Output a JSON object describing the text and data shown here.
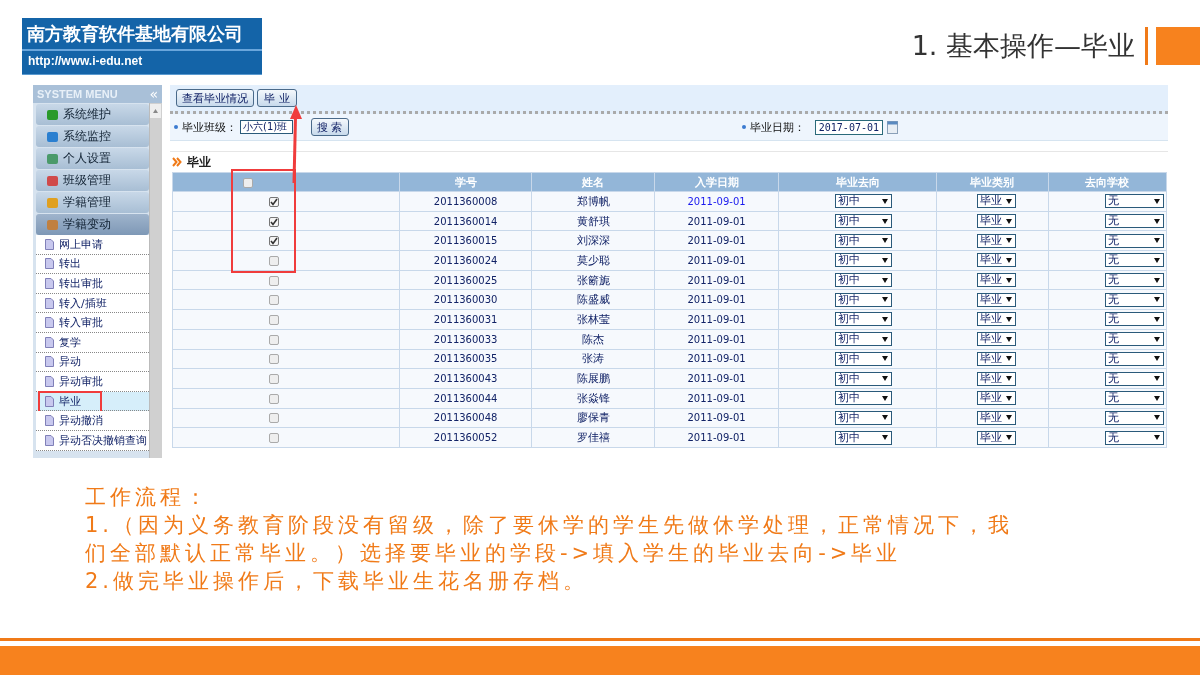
{
  "logo": {
    "name": "南方教育软件基地有限公司",
    "url": "http://www.i-edu.net"
  },
  "slide_title": "1. 基本操作—毕业",
  "sidebar": {
    "title": "SYSTEM MENU",
    "collapse": "«",
    "groups": [
      {
        "label": "系统维护",
        "expanded": false
      },
      {
        "label": "系统监控",
        "expanded": false
      },
      {
        "label": "个人设置",
        "expanded": false
      },
      {
        "label": "班级管理",
        "expanded": false
      },
      {
        "label": "学籍管理",
        "expanded": false
      },
      {
        "label": "学籍变动",
        "expanded": true
      }
    ],
    "items": [
      {
        "label": "网上申请",
        "selected": false
      },
      {
        "label": "转出",
        "selected": false
      },
      {
        "label": "转出审批",
        "selected": false
      },
      {
        "label": "转入/插班",
        "selected": false
      },
      {
        "label": "转入审批",
        "selected": false
      },
      {
        "label": "复学",
        "selected": false
      },
      {
        "label": "异动",
        "selected": false
      },
      {
        "label": "异动审批",
        "selected": false
      },
      {
        "label": "毕业",
        "selected": true
      },
      {
        "label": "异动撤消",
        "selected": false
      },
      {
        "label": "异动否决撤销查询",
        "selected": false
      }
    ]
  },
  "toolbar": [
    "查看毕业情况",
    "毕 业"
  ],
  "filter": {
    "class_label": "毕业班级：",
    "class_value": "小六(1)班",
    "search_button": "搜 索",
    "date_label": "毕业日期：",
    "date_value": "2017-07-01"
  },
  "section_title": "毕业",
  "table": {
    "header_checked": false,
    "columns": [
      "学号",
      "姓名",
      "入学日期",
      "毕业去向",
      "毕业类别",
      "去向学校"
    ],
    "rows": [
      {
        "checked": true,
        "student_id": "2011360008",
        "name": "郑博帆",
        "enroll_date": "2011-09-01",
        "highlighted": true,
        "destination": "初中",
        "category": "毕业",
        "school": "无"
      },
      {
        "checked": true,
        "student_id": "2011360014",
        "name": "黄舒琪",
        "enroll_date": "2011-09-01",
        "highlighted": false,
        "destination": "初中",
        "category": "毕业",
        "school": "无"
      },
      {
        "checked": true,
        "student_id": "2011360015",
        "name": "刘深深",
        "enroll_date": "2011-09-01",
        "highlighted": false,
        "destination": "初中",
        "category": "毕业",
        "school": "无"
      },
      {
        "checked": false,
        "student_id": "2011360024",
        "name": "莫少聪",
        "enroll_date": "2011-09-01",
        "highlighted": false,
        "destination": "初中",
        "category": "毕业",
        "school": "无"
      },
      {
        "checked": false,
        "student_id": "2011360025",
        "name": "张簖旎",
        "enroll_date": "2011-09-01",
        "highlighted": false,
        "destination": "初中",
        "category": "毕业",
        "school": "无"
      },
      {
        "checked": false,
        "student_id": "2011360030",
        "name": "陈盛威",
        "enroll_date": "2011-09-01",
        "highlighted": false,
        "destination": "初中",
        "category": "毕业",
        "school": "无"
      },
      {
        "checked": false,
        "student_id": "2011360031",
        "name": "张林莹",
        "enroll_date": "2011-09-01",
        "highlighted": false,
        "destination": "初中",
        "category": "毕业",
        "school": "无"
      },
      {
        "checked": false,
        "student_id": "2011360033",
        "name": "陈杰",
        "enroll_date": "2011-09-01",
        "highlighted": false,
        "destination": "初中",
        "category": "毕业",
        "school": "无"
      },
      {
        "checked": false,
        "student_id": "2011360035",
        "name": "张涛",
        "enroll_date": "2011-09-01",
        "highlighted": false,
        "destination": "初中",
        "category": "毕业",
        "school": "无"
      },
      {
        "checked": false,
        "student_id": "2011360043",
        "name": "陈展鹏",
        "enroll_date": "2011-09-01",
        "highlighted": false,
        "destination": "初中",
        "category": "毕业",
        "school": "无"
      },
      {
        "checked": false,
        "student_id": "2011360044",
        "name": "张焱锋",
        "enroll_date": "2011-09-01",
        "highlighted": false,
        "destination": "初中",
        "category": "毕业",
        "school": "无"
      },
      {
        "checked": false,
        "student_id": "2011360048",
        "name": "廖保青",
        "enroll_date": "2011-09-01",
        "highlighted": false,
        "destination": "初中",
        "category": "毕业",
        "school": "无"
      },
      {
        "checked": false,
        "student_id": "2011360052",
        "name": "罗佳禧",
        "enroll_date": "2011-09-01",
        "highlighted": false,
        "destination": "初中",
        "category": "毕业",
        "school": "无"
      }
    ]
  },
  "notes": [
    "工作流程：",
    "1.（因为义务教育阶段没有留级，除了要休学的学生先做休学处理，正常情况下，我们全部默认正常毕业。）选择要毕业的学段->填入学生的毕业去向->毕业",
    "2.做完毕业操作后，下载毕业生花名册存档。"
  ]
}
